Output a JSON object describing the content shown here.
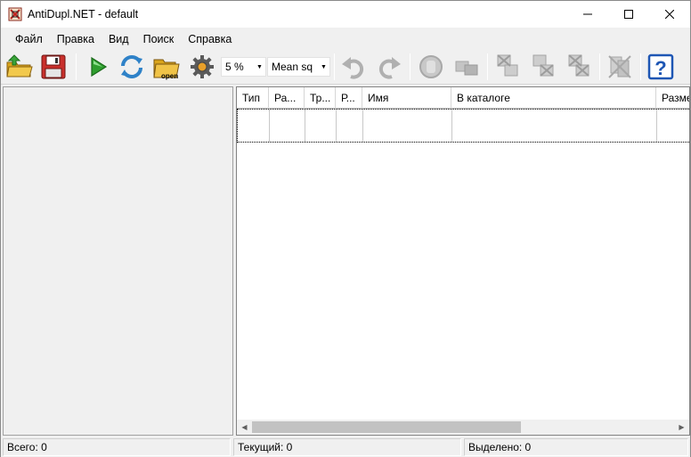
{
  "window": {
    "title": "AntiDupl.NET - default",
    "controls": {
      "minimize": "minimize-icon",
      "maximize": "maximize-icon",
      "close": "close-icon"
    }
  },
  "menu": {
    "items": [
      "Файл",
      "Правка",
      "Вид",
      "Поиск",
      "Справка"
    ]
  },
  "toolbar": {
    "threshold_value": "5 %",
    "algorithm_value": "Mean sq",
    "open_icon_text": "open",
    "help_icon_text": "?",
    "icons": [
      "load-icon",
      "save-icon",
      "play-icon",
      "refresh-icon",
      "open-folder-icon",
      "settings-gear-icon",
      "undo-icon",
      "redo-icon",
      "stop-icon",
      "hint-icon",
      "delete-first-icon",
      "delete-second-icon",
      "delete-both-icon",
      "mistake-icon",
      "help-icon"
    ],
    "accent_colors": {
      "play": "#2e9e2e",
      "refresh": "#2f82c8",
      "help": "#1e56b4",
      "folder": "#d9a41c"
    }
  },
  "grid": {
    "columns": [
      "Тип",
      "Ра...",
      "Тр...",
      "Р...",
      "Имя",
      "В каталоге",
      "Разме"
    ],
    "rows": [
      [
        "",
        "",
        "",
        "",
        "",
        "",
        ""
      ]
    ]
  },
  "status": {
    "total": "Всего: 0",
    "current": "Текущий: 0",
    "selected": "Выделено: 0"
  }
}
